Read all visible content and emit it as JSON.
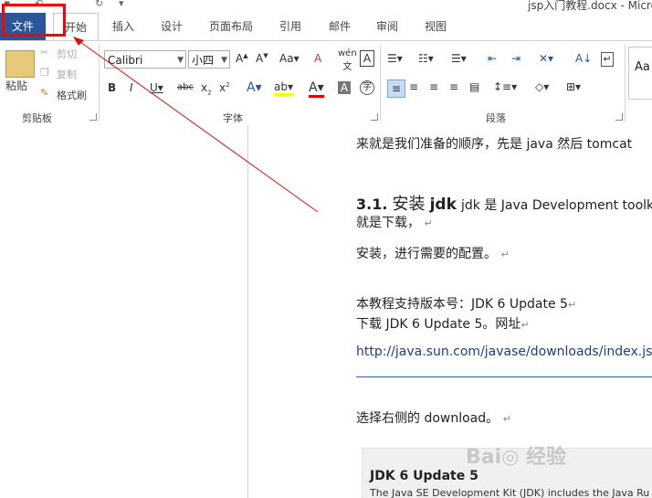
{
  "window": {
    "title": "jsp入门教程.docx - Micro"
  },
  "tabs": [
    {
      "label": "文件"
    },
    {
      "label": "开始"
    },
    {
      "label": "插入"
    },
    {
      "label": "设计"
    },
    {
      "label": "页面布局"
    },
    {
      "label": "引用"
    },
    {
      "label": "邮件"
    },
    {
      "label": "审阅"
    },
    {
      "label": "视图"
    }
  ],
  "ribbon": {
    "clipboard": {
      "label": "剪贴板",
      "paste": "粘贴",
      "cut": "剪切",
      "copy": "复制",
      "format_painter": "格式刷"
    },
    "font": {
      "label": "字体",
      "font_name": "Calibri",
      "font_size": "小四"
    },
    "paragraph": {
      "label": "段落"
    },
    "styles": {
      "sample": "Aa"
    }
  },
  "document": {
    "line1": "来就是我们准备的顺序，先是 java 然后 tomcat",
    "heading_num": "3.1.",
    "heading_text": "安装",
    "heading_bold": "jdk",
    "heading_rest": "jdk 是 Java Development toolkit",
    "line2": "就是下载，",
    "line3": "安装，进行需要的配置。",
    "line4": "本教程支持版本号：JDK 6 Update 5",
    "line5": "下载 JDK 6 Update 5。网址",
    "link": "http://java.sun.com/javase/downloads/index.jsp",
    "line6": "选择右侧的 download。",
    "jdk_box_title": "JDK 6 Update 5",
    "jdk_box_desc": "The Java SE Development Kit (JDK) includes the Java Ru"
  },
  "colors": {
    "file_tab": "#2b579a",
    "highlight": "#ff0000",
    "link": "#1f3c88"
  }
}
